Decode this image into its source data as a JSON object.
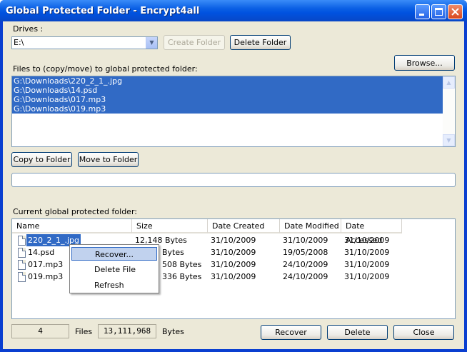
{
  "window": {
    "title": "Global Protected Folder - Encrypt4all"
  },
  "drives": {
    "label": "Drives :",
    "value": "E:\\"
  },
  "buttons": {
    "create_folder": "Create Folder",
    "delete_folder": "Delete Folder",
    "browse": "Browse...",
    "copy_to_folder": "Copy to Folder",
    "move_to_folder": "Move to Folder",
    "recover": "Recover",
    "delete": "Delete",
    "close": "Close"
  },
  "files_to_copy": {
    "label": "Files to (copy/move) to global protected folder:",
    "items": [
      "G:\\Downloads\\220_2_1_.jpg",
      "G:\\Downloads\\14.psd",
      "G:\\Downloads\\017.mp3",
      "G:\\Downloads\\019.mp3"
    ]
  },
  "current_folder": {
    "label": "Current global protected folder:",
    "columns": [
      "Name",
      "Size",
      "Date Created",
      "Date Modified",
      "Date Accessed"
    ],
    "rows": [
      {
        "name": "220_2_1_.jpg",
        "size": "12,148 Bytes",
        "created": "31/10/2009",
        "modified": "31/10/2009",
        "accessed": "31/10/2009"
      },
      {
        "name": "14.psd",
        "size": "Bytes",
        "created": "31/10/2009",
        "modified": "19/05/2008",
        "accessed": "31/10/2009"
      },
      {
        "name": "017.mp3",
        "size": "508 Bytes",
        "created": "31/10/2009",
        "modified": "24/10/2009",
        "accessed": "31/10/2009"
      },
      {
        "name": "019.mp3",
        "size": "336 Bytes",
        "created": "31/10/2009",
        "modified": "24/10/2009",
        "accessed": "31/10/2009"
      }
    ]
  },
  "context_menu": {
    "items": [
      "Recover...",
      "Delete File",
      "Refresh"
    ]
  },
  "status": {
    "file_count": "4",
    "files_label": "Files",
    "bytes_value": "13,111,968",
    "bytes_label": "Bytes"
  }
}
